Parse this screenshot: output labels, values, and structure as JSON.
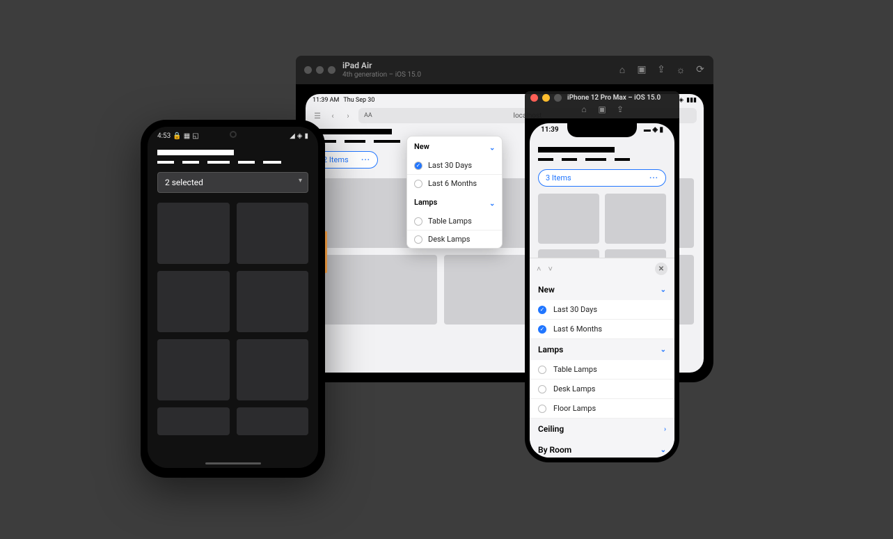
{
  "ipad": {
    "chrome": {
      "title": "iPad Air",
      "sub": "4th generation – iOS 15.0"
    },
    "statusbar": {
      "time": "11:39 AM",
      "date": "Thu Sep 30"
    },
    "addr": {
      "aa": "AA",
      "url": "localhost"
    },
    "pill": {
      "label": "2 Items",
      "ell": "···"
    },
    "popover": {
      "s1": {
        "title": "New",
        "r1": "Last 30 Days",
        "r2": "Last 6 Months"
      },
      "s2": {
        "title": "Lamps",
        "r1": "Table Lamps",
        "r2": "Desk Lamps"
      }
    }
  },
  "iphone": {
    "chrome": {
      "title": "iPhone 12 Pro Max – iOS 15.0"
    },
    "status": {
      "time": "11:39"
    },
    "pill": {
      "label": "3 Items",
      "ell": "···"
    },
    "sheet": {
      "s1": {
        "title": "New",
        "r1": "Last 30 Days",
        "r2": "Last 6 Months"
      },
      "s2": {
        "title": "Lamps",
        "r1": "Table Lamps",
        "r2": "Desk Lamps",
        "r3": "Floor Lamps"
      },
      "s3": {
        "title": "Ceiling"
      },
      "s4": {
        "title": "By Room"
      }
    }
  },
  "android": {
    "status": {
      "time": "4:53"
    },
    "select": {
      "label": "2 selected"
    }
  }
}
